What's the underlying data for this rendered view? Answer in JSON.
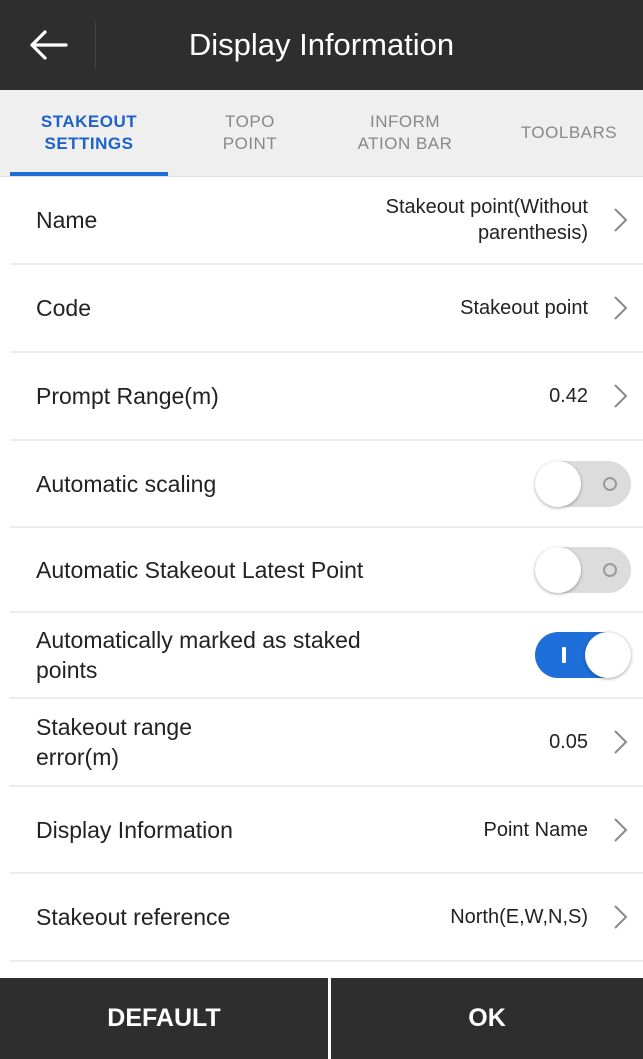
{
  "header": {
    "title": "Display Information",
    "back_icon": "arrow-left-icon"
  },
  "tabs": [
    {
      "line1": "STAKEOUT",
      "line2": "SETTINGS",
      "active": true
    },
    {
      "line1": "TOPO",
      "line2": "POINT",
      "active": false
    },
    {
      "line1": "INFORM",
      "line2": "ATION BAR",
      "active": false
    },
    {
      "line1": "TOOLBARS",
      "line2": "",
      "active": false
    }
  ],
  "settings": {
    "name": {
      "label": "Name",
      "value_line1": "Stakeout point(Without",
      "value_line2": "parenthesis)"
    },
    "code": {
      "label": "Code",
      "value": "Stakeout point"
    },
    "prompt_range": {
      "label": "Prompt Range(m)",
      "value": "0.42"
    },
    "auto_scaling": {
      "label": "Automatic scaling",
      "on": false
    },
    "auto_latest": {
      "label": "Automatic Stakeout Latest Point",
      "on": false
    },
    "auto_marked": {
      "label_line1": "Automatically marked as staked",
      "label_line2": "points",
      "on": true
    },
    "range_error": {
      "label_line1": "Stakeout range",
      "label_line2": "error(m)",
      "value": "0.05"
    },
    "display_info": {
      "label": "Display Information",
      "value": "Point Name"
    },
    "reference": {
      "label": "Stakeout reference",
      "value": "North(E,W,N,S)"
    }
  },
  "footer": {
    "default_label": "DEFAULT",
    "ok_label": "OK"
  },
  "colors": {
    "bar_bg": "#2e2e2e",
    "accent": "#1e6fd9",
    "tab_bg": "#efefef"
  }
}
